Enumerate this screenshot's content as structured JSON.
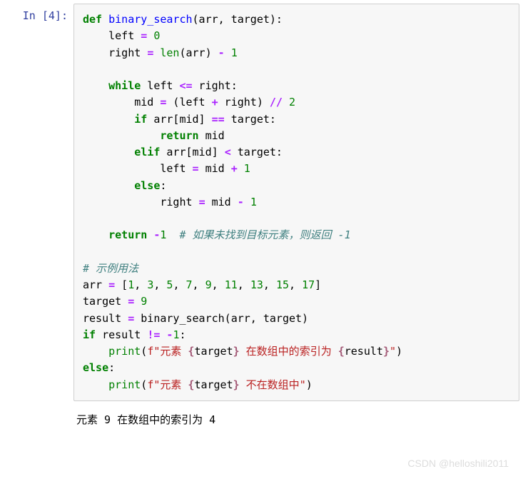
{
  "prompt": {
    "label": "In  [4]:"
  },
  "code": {
    "line1_def": "def",
    "line1_fname": " binary_search",
    "line1_paren": "(arr, target):",
    "line2_a": "    left ",
    "line2_eq": "=",
    "line2_b": " ",
    "line2_num": "0",
    "line3_a": "    right ",
    "line3_eq": "=",
    "line3_b": " ",
    "line3_len": "len",
    "line3_c": "(arr) ",
    "line3_minus": "-",
    "line3_d": " ",
    "line3_num": "1",
    "line5_a": "    ",
    "line5_while": "while",
    "line5_b": " left ",
    "line5_le": "<=",
    "line5_c": " right:",
    "line6_a": "        mid ",
    "line6_eq": "=",
    "line6_b": " (left ",
    "line6_plus": "+",
    "line6_c": " right) ",
    "line6_floordiv": "//",
    "line6_d": " ",
    "line6_num": "2",
    "line7_a": "        ",
    "line7_if": "if",
    "line7_b": " arr[mid] ",
    "line7_eqeq": "==",
    "line7_c": " target:",
    "line8_a": "            ",
    "line8_return": "return",
    "line8_b": " mid",
    "line9_a": "        ",
    "line9_elif": "elif",
    "line9_b": " arr[mid] ",
    "line9_lt": "<",
    "line9_c": " target:",
    "line10_a": "            left ",
    "line10_eq": "=",
    "line10_b": " mid ",
    "line10_plus": "+",
    "line10_c": " ",
    "line10_num": "1",
    "line11_a": "        ",
    "line11_else": "else",
    "line11_b": ":",
    "line12_a": "            right ",
    "line12_eq": "=",
    "line12_b": " mid ",
    "line12_minus": "-",
    "line12_c": " ",
    "line12_num": "1",
    "line14_a": "    ",
    "line14_return": "return",
    "line14_b": " ",
    "line14_neg": "-",
    "line14_num": "1",
    "line14_c": "  ",
    "line14_comment": "# 如果未找到目标元素，则返回 -1",
    "line16_comment": "# 示例用法",
    "line17_a": "arr ",
    "line17_eq": "=",
    "line17_b": " [",
    "line17_n1": "1",
    "line17_c1": ", ",
    "line17_n2": "3",
    "line17_c2": ", ",
    "line17_n3": "5",
    "line17_c3": ", ",
    "line17_n4": "7",
    "line17_c4": ", ",
    "line17_n5": "9",
    "line17_c5": ", ",
    "line17_n6": "11",
    "line17_c6": ", ",
    "line17_n7": "13",
    "line17_c7": ", ",
    "line17_n8": "15",
    "line17_c8": ", ",
    "line17_n9": "17",
    "line17_end": "]",
    "line18_a": "target ",
    "line18_eq": "=",
    "line18_b": " ",
    "line18_num": "9",
    "line19_a": "result ",
    "line19_eq": "=",
    "line19_b": " binary_search(arr, target)",
    "line20_if": "if",
    "line20_a": " result ",
    "line20_ne": "!=",
    "line20_b": " ",
    "line20_neg": "-",
    "line20_num": "1",
    "line20_c": ":",
    "line21_a": "    ",
    "line21_print": "print",
    "line21_b": "(",
    "line21_f": "f\"元素 ",
    "line21_i1a": "{",
    "line21_i1b": "target",
    "line21_i1c": "}",
    "line21_mid": " 在数组中的索引为 ",
    "line21_i2a": "{",
    "line21_i2b": "result",
    "line21_i2c": "}",
    "line21_end": "\"",
    "line21_close": ")",
    "line22_else": "else",
    "line22_b": ":",
    "line23_a": "    ",
    "line23_print": "print",
    "line23_b": "(",
    "line23_f": "f\"元素 ",
    "line23_i1a": "{",
    "line23_i1b": "target",
    "line23_i1c": "}",
    "line23_mid": " 不在数组中\"",
    "line23_close": ")"
  },
  "output": "元素 9 在数组中的索引为 4",
  "watermark": "CSDN @helloshili2011"
}
